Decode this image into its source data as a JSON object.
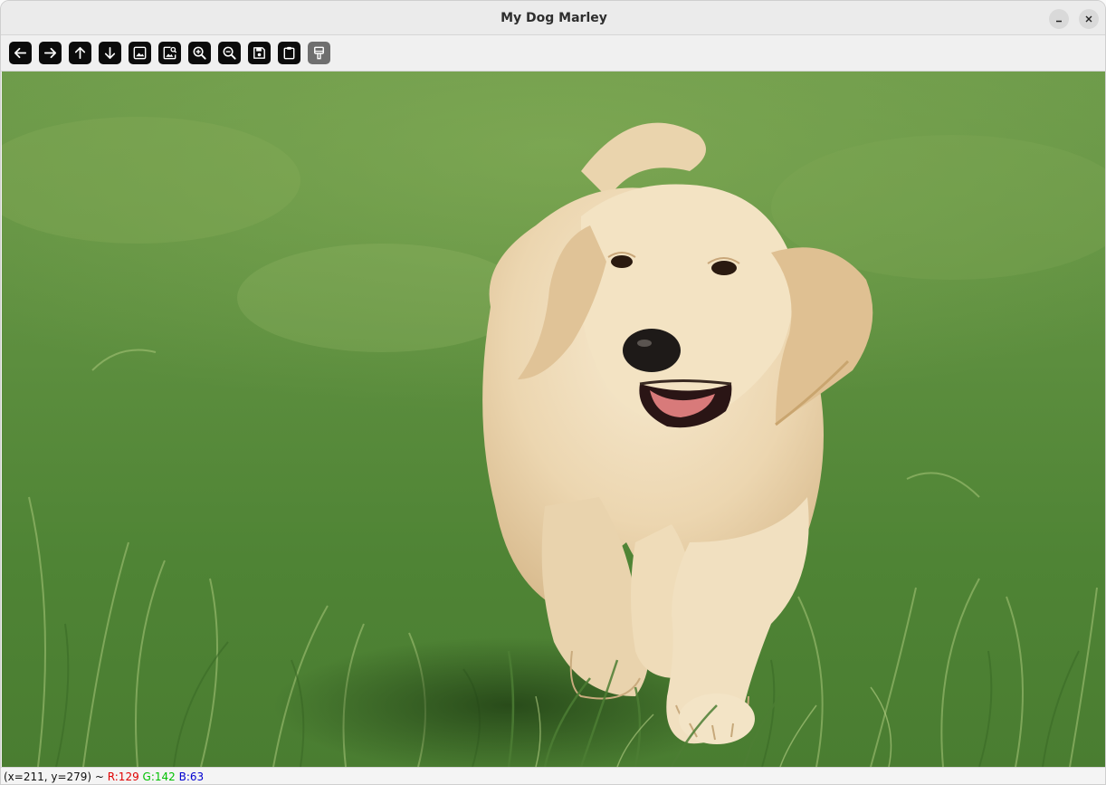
{
  "window": {
    "title": "My Dog Marley",
    "controls": {
      "minimize_icon": "minimize-icon",
      "close_icon": "close-icon"
    }
  },
  "toolbar": {
    "buttons": [
      {
        "name": "pan-left",
        "icon": "arrow-left-icon",
        "enabled": true
      },
      {
        "name": "pan-right",
        "icon": "arrow-right-icon",
        "enabled": true
      },
      {
        "name": "pan-up",
        "icon": "arrow-up-icon",
        "enabled": true
      },
      {
        "name": "pan-down",
        "icon": "arrow-down-icon",
        "enabled": true
      },
      {
        "name": "original-size",
        "icon": "image-icon",
        "enabled": true
      },
      {
        "name": "fit-image",
        "icon": "image-zoom-icon",
        "enabled": true
      },
      {
        "name": "zoom-in",
        "icon": "zoom-in-icon",
        "enabled": true
      },
      {
        "name": "zoom-out",
        "icon": "zoom-out-icon",
        "enabled": true
      },
      {
        "name": "save-image",
        "icon": "save-icon",
        "enabled": true
      },
      {
        "name": "copy-clipboard",
        "icon": "clipboard-icon",
        "enabled": true
      },
      {
        "name": "properties",
        "icon": "brush-icon",
        "enabled": false
      }
    ]
  },
  "image": {
    "subject": "puppy-photo",
    "colors": {
      "grass": "#5a8a3a",
      "fur": "#e8d2ac"
    }
  },
  "status": {
    "coords": "(x=211, y=279) ~ ",
    "r": "R:129",
    "g": "G:142",
    "b": "B:63",
    "colors": {
      "r": "#e00000",
      "g": "#00c000",
      "b": "#0000d0"
    }
  }
}
